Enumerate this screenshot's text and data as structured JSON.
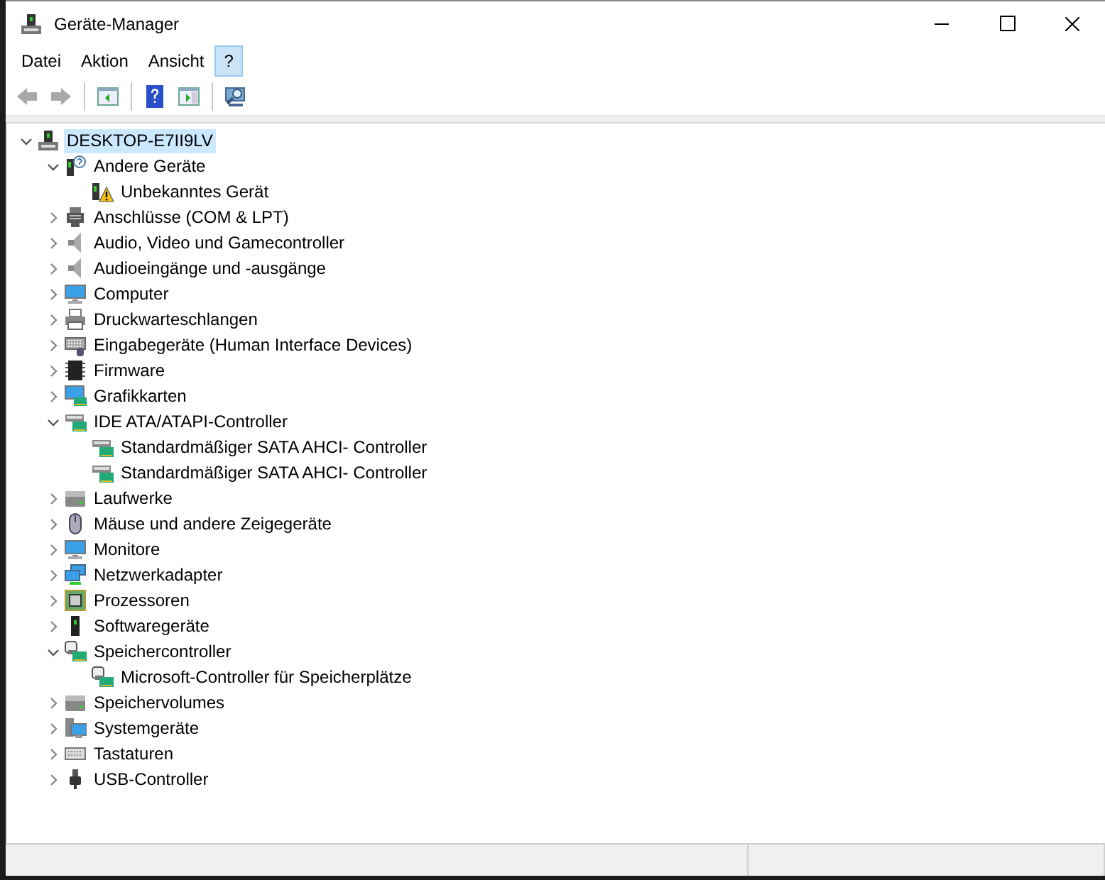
{
  "window": {
    "title": "Geräte-Manager"
  },
  "menu": [
    {
      "label": "Datei",
      "selected": false
    },
    {
      "label": "Aktion",
      "selected": false
    },
    {
      "label": "Ansicht",
      "selected": false
    },
    {
      "label": "?",
      "selected": true
    }
  ],
  "toolbar": [
    {
      "kind": "back",
      "disabled": true
    },
    {
      "kind": "forward",
      "disabled": true
    },
    {
      "kind": "sep"
    },
    {
      "kind": "tree-pane"
    },
    {
      "kind": "sep"
    },
    {
      "kind": "help"
    },
    {
      "kind": "action-pane"
    },
    {
      "kind": "sep"
    },
    {
      "kind": "scan"
    }
  ],
  "tree": [
    {
      "label": "DESKTOP-E7II9LV",
      "kind": "computer-node",
      "expanded": true,
      "selected": true,
      "children": [
        {
          "label": "Andere Geräte",
          "kind": "unknown",
          "expanded": true,
          "selected": false,
          "children": [
            {
              "label": "Unbekanntes Gerät",
              "kind": "warning",
              "selected": false
            }
          ]
        },
        {
          "label": "Anschlüsse (COM & LPT)",
          "kind": "port",
          "expanded": false,
          "selected": false
        },
        {
          "label": "Audio, Video und Gamecontroller",
          "kind": "speaker",
          "expanded": false,
          "selected": false
        },
        {
          "label": "Audioeingänge und -ausgänge",
          "kind": "speaker",
          "expanded": false,
          "selected": false
        },
        {
          "label": "Computer",
          "kind": "monitor",
          "expanded": false,
          "selected": false
        },
        {
          "label": "Druckwarteschlangen",
          "kind": "printer",
          "expanded": false,
          "selected": false
        },
        {
          "label": "Eingabegeräte (Human Interface Devices)",
          "kind": "hid",
          "expanded": false,
          "selected": false
        },
        {
          "label": "Firmware",
          "kind": "chip",
          "expanded": false,
          "selected": false
        },
        {
          "label": "Grafikkarten",
          "kind": "display",
          "expanded": false,
          "selected": false
        },
        {
          "label": "IDE ATA/ATAPI-Controller",
          "kind": "controller",
          "expanded": true,
          "selected": false,
          "children": [
            {
              "label": "Standardmäßiger SATA AHCI- Controller",
              "kind": "controller",
              "selected": false
            },
            {
              "label": "Standardmäßiger SATA AHCI- Controller",
              "kind": "controller",
              "selected": false
            }
          ]
        },
        {
          "label": "Laufwerke",
          "kind": "drive",
          "expanded": false,
          "selected": false
        },
        {
          "label": "Mäuse und andere Zeigegeräte",
          "kind": "mouse",
          "expanded": false,
          "selected": false
        },
        {
          "label": "Monitore",
          "kind": "monitor",
          "expanded": false,
          "selected": false
        },
        {
          "label": "Netzwerkadapter",
          "kind": "network",
          "expanded": false,
          "selected": false
        },
        {
          "label": "Prozessoren",
          "kind": "processor",
          "expanded": false,
          "selected": false
        },
        {
          "label": "Softwaregeräte",
          "kind": "software",
          "expanded": false,
          "selected": false
        },
        {
          "label": "Speichercontroller",
          "kind": "storage",
          "expanded": true,
          "selected": false,
          "children": [
            {
              "label": "Microsoft-Controller für Speicherplätze",
              "kind": "storage",
              "selected": false
            }
          ]
        },
        {
          "label": "Speichervolumes",
          "kind": "drive",
          "expanded": false,
          "selected": false
        },
        {
          "label": "Systemgeräte",
          "kind": "system",
          "expanded": false,
          "selected": false
        },
        {
          "label": "Tastaturen",
          "kind": "keyboard",
          "expanded": false,
          "selected": false
        },
        {
          "label": "USB-Controller",
          "kind": "usb",
          "expanded": false,
          "selected": false
        }
      ]
    }
  ]
}
